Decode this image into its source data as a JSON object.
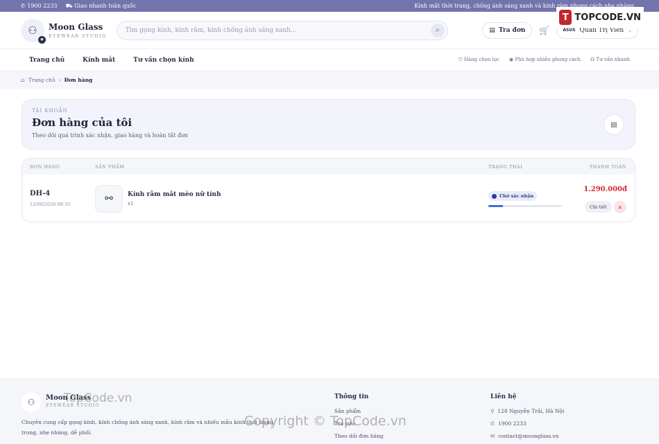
{
  "topbar": {
    "phone": "1900 2233",
    "shipping": "Giao nhanh toàn quốc",
    "tagline": "Kính mắt thời trang, chống ánh sáng xanh và kính râm phong cách nhẹ nhàng"
  },
  "watermark_logo": "TOPCODE.VN",
  "brand": {
    "name": "Moon Glass",
    "sub": "EYEWEAR STUDIO"
  },
  "search": {
    "placeholder": "Tìm gọng kính, kính râm, kính chống ánh sáng xanh..."
  },
  "header": {
    "track": "Tra đơn",
    "user": "Quản Trị Viên"
  },
  "nav": {
    "items": [
      "Trang chủ",
      "Kính mắt",
      "Tư vấn chọn kính"
    ],
    "features": [
      "Hàng chọn lọc",
      "Phù hợp nhiều phong cách",
      "Tư vấn nhanh"
    ]
  },
  "breadcrumb": {
    "home": "Trang chủ",
    "current": "Đơn hàng"
  },
  "hero": {
    "kicker": "TÀI KHOẢN",
    "title": "Đơn hàng của tôi",
    "desc": "Theo dõi quá trình xác nhận, giao hàng và hoàn tất đơn"
  },
  "table": {
    "headers": [
      "ĐƠN HÀNG",
      "SẢN PHẨM",
      "TRẠNG THÁI",
      "THANH TOÁN"
    ],
    "rows": [
      {
        "id": "DH-4",
        "date": "12/08/2026 08:35",
        "product": "Kính râm mắt mèo nữ tính",
        "qty": "x1",
        "status": "Chờ xác nhận",
        "progress": 0.2,
        "total": "1.290.000đ",
        "detail": "Chi tiết",
        "cancel": "×"
      }
    ]
  },
  "footer": {
    "brand": "Moon Glass",
    "sub": "EYEWEAR STUDIO",
    "desc1": "Chuyên cung cấp gọng kính, kính chống ánh sáng xanh, kính râm và nhiều mẫu kính thời trang",
    "desc2": "trung, nhẹ nhàng, dễ phối.",
    "info_title": "Thông tin",
    "info": [
      "Sản phẩm",
      "Tra cứu",
      "Theo dõi đơn hàng"
    ],
    "contact_title": "Liên hệ",
    "contact": [
      "128 Nguyễn Trãi, Hà Nội",
      "1900 2233",
      "contact@moonglass.vn"
    ]
  },
  "watermarks": [
    "TopCode.vn",
    "Copyright © TopCode.vn"
  ]
}
